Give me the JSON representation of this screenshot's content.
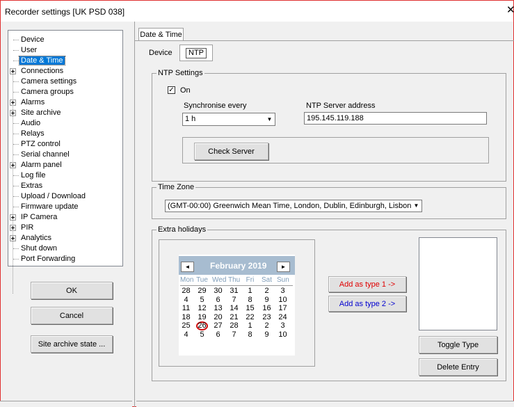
{
  "window": {
    "title": "Recorder settings [UK PSD 038]",
    "close_glyph": "✕"
  },
  "tree": {
    "items": [
      {
        "label": "Device",
        "expandable": false
      },
      {
        "label": "User",
        "expandable": false
      },
      {
        "label": "Date & Time",
        "expandable": false,
        "selected": true
      },
      {
        "label": "Connections",
        "expandable": true
      },
      {
        "label": "Camera settings",
        "expandable": false
      },
      {
        "label": "Camera groups",
        "expandable": false
      },
      {
        "label": "Alarms",
        "expandable": true
      },
      {
        "label": "Site archive",
        "expandable": true
      },
      {
        "label": "Audio",
        "expandable": false
      },
      {
        "label": "Relays",
        "expandable": false
      },
      {
        "label": "PTZ control",
        "expandable": false
      },
      {
        "label": "Serial channel",
        "expandable": false
      },
      {
        "label": "Alarm panel",
        "expandable": true
      },
      {
        "label": "Log file",
        "expandable": false
      },
      {
        "label": "Extras",
        "expandable": false
      },
      {
        "label": "Upload / Download",
        "expandable": false
      },
      {
        "label": "Firmware update",
        "expandable": false
      },
      {
        "label": "IP Camera",
        "expandable": true
      },
      {
        "label": "PIR",
        "expandable": true
      },
      {
        "label": "Analytics",
        "expandable": true
      },
      {
        "label": "Shut down",
        "expandable": false
      },
      {
        "label": "Port Forwarding",
        "expandable": false
      }
    ]
  },
  "left_buttons": {
    "ok": "OK",
    "cancel": "Cancel",
    "site_archive_state": "Site archive state ..."
  },
  "tabs": {
    "main": "Date & Time",
    "sub_device": "Device",
    "sub_ntp": "NTP"
  },
  "ntp": {
    "group_label": "NTP Settings",
    "on_label": "On",
    "on_checked": true,
    "check_glyph": "✓",
    "sync_label": "Synchronise every",
    "sync_value": "1 h",
    "server_label": "NTP Server address",
    "server_value": "195.145.119.188",
    "check_server": "Check Server"
  },
  "timezone": {
    "group_label": "Time Zone",
    "value": "(GMT-00:00) Greenwich Mean Time, London, Dublin, Edinburgh, Lisbon"
  },
  "holidays": {
    "group_label": "Extra holidays",
    "add_type1": "Add as type 1 ->",
    "add_type2": "Add as type 2 ->",
    "toggle_type": "Toggle Type",
    "delete_entry": "Delete Entry",
    "calendar": {
      "title": "February 2019",
      "prev_glyph": "◄",
      "next_glyph": "►",
      "dow": [
        "Mon",
        "Tue",
        "Wed",
        "Thu",
        "Fri",
        "Sat",
        "Sun"
      ],
      "weeks": [
        [
          "28",
          "29",
          "30",
          "31",
          "1",
          "2",
          "3"
        ],
        [
          "4",
          "5",
          "6",
          "7",
          "8",
          "9",
          "10"
        ],
        [
          "11",
          "12",
          "13",
          "14",
          "15",
          "16",
          "17"
        ],
        [
          "18",
          "19",
          "20",
          "21",
          "22",
          "23",
          "24"
        ],
        [
          "25",
          "26",
          "27",
          "28",
          "1",
          "2",
          "3"
        ],
        [
          "4",
          "5",
          "6",
          "7",
          "8",
          "9",
          "10"
        ]
      ],
      "today_circled": "26"
    }
  },
  "colors": {
    "selected": "#0078d7",
    "calendar_header": "#a7bcd0",
    "red_text": "#e00000",
    "blue_text": "#0000d0"
  },
  "icons": {
    "combo_arrow": "▼",
    "tree_plus": "plus-box-icon"
  }
}
